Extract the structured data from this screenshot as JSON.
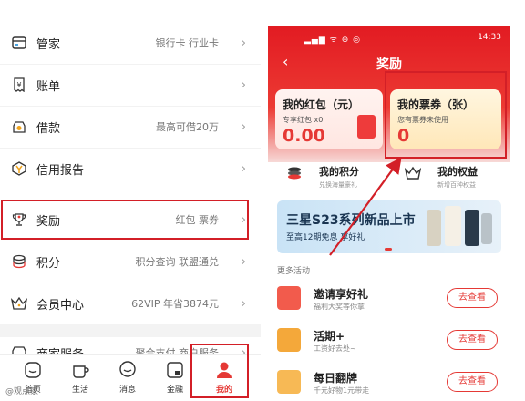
{
  "left_menu": [
    {
      "label": "管家",
      "value": "银行卡 行业卡",
      "icon": "card-icon"
    },
    {
      "label": "账单",
      "value": "",
      "icon": "bill-icon"
    },
    {
      "label": "借款",
      "value": "最高可借20万",
      "icon": "loan-icon"
    },
    {
      "label": "信用报告",
      "value": "",
      "icon": "credit-report-icon"
    },
    {
      "label": "奖励",
      "value": "红包 票券",
      "icon": "trophy-icon"
    },
    {
      "label": "积分",
      "value": "积分查询 联盟通兑",
      "icon": "points-icon"
    },
    {
      "label": "会员中心",
      "value": "62VIP 年省3874元",
      "icon": "crown-icon"
    },
    {
      "label": "商家服务",
      "value": "聚合支付 商户服务",
      "icon": "merchant-icon"
    }
  ],
  "bottom_nav": [
    {
      "label": "首页",
      "icon": "home-icon"
    },
    {
      "label": "生活",
      "icon": "life-icon"
    },
    {
      "label": "消息",
      "icon": "message-icon"
    },
    {
      "label": "金融",
      "icon": "finance-icon"
    },
    {
      "label": "我的",
      "icon": "profile-icon",
      "active": true
    }
  ],
  "watermark": "@观点家",
  "right": {
    "status_time": "14:33",
    "page_title": "奖励",
    "red_packet_card": {
      "title": "我的红包（元）",
      "sub": "专享红包 x0",
      "value": "0.00"
    },
    "coupon_card": {
      "title": "我的票券（张）",
      "sub": "您有票券未使用",
      "value": "0"
    },
    "points_link": {
      "title": "我的积分",
      "sub": "兑换海量豪礼"
    },
    "rights_link": {
      "title": "我的权益",
      "sub": "新增百种权益"
    },
    "banner": {
      "title": "三星S23系列新品上市",
      "sub": "至高12期免息 享好礼"
    },
    "more_activities_label": "更多活动",
    "activities": [
      {
        "title": "邀请享好礼",
        "sub": "福利大奖等你拿",
        "button": "去查看"
      },
      {
        "title": "活期+",
        "sub": "工资好去处~",
        "button": "去查看"
      },
      {
        "title": "每日翻牌",
        "sub": "千元好物1元带走",
        "button": "去查看"
      }
    ]
  },
  "colors": {
    "brand_red": "#d31f27",
    "accent_red": "#e53935"
  }
}
